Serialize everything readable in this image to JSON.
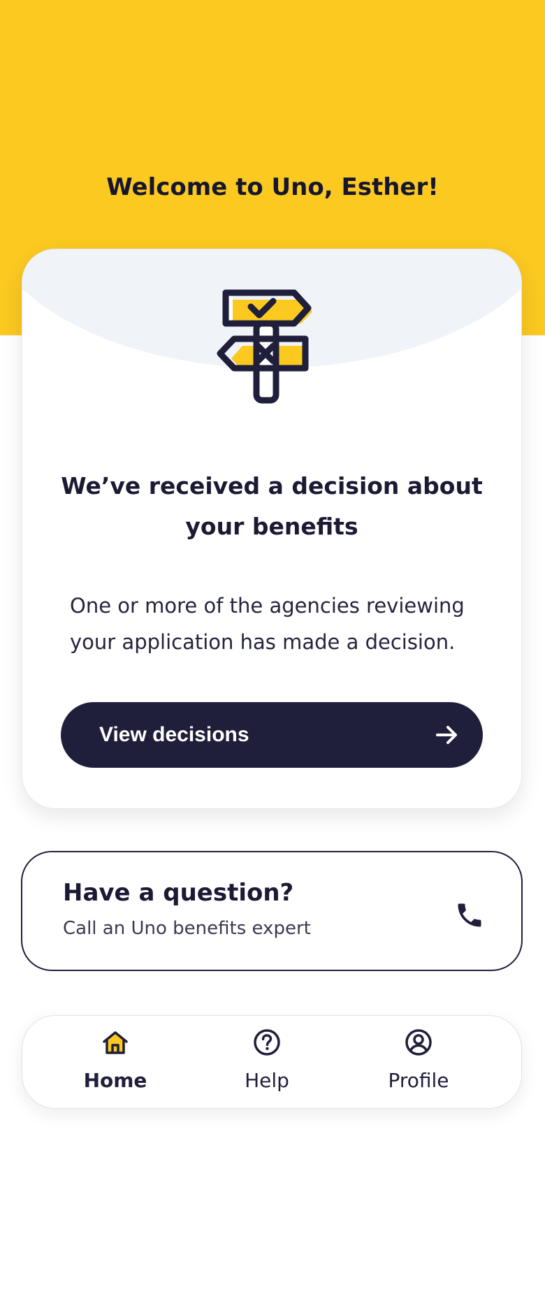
{
  "header": {
    "welcome_title": "Welcome to Uno, Esther!"
  },
  "decision_card": {
    "illustration": "signpost-icon",
    "heading": "We’ve received a decision about your benefits",
    "body": "One or more of the agencies reviewing your application has made a decision.",
    "button_label": "View decisions",
    "button_icon": "arrow-right-icon"
  },
  "question_card": {
    "title": "Have a question?",
    "subtitle": "Call an Uno benefits expert",
    "icon": "phone-icon"
  },
  "nav": {
    "items": [
      {
        "label": "Home",
        "icon": "home-icon",
        "active": true
      },
      {
        "label": "Help",
        "icon": "help-circle-icon",
        "active": false
      },
      {
        "label": "Profile",
        "icon": "profile-icon",
        "active": false
      }
    ]
  },
  "colors": {
    "brand_yellow": "#fbc920",
    "navy": "#1f1f3b",
    "card_wash": "#f0f3f8",
    "white": "#ffffff"
  }
}
